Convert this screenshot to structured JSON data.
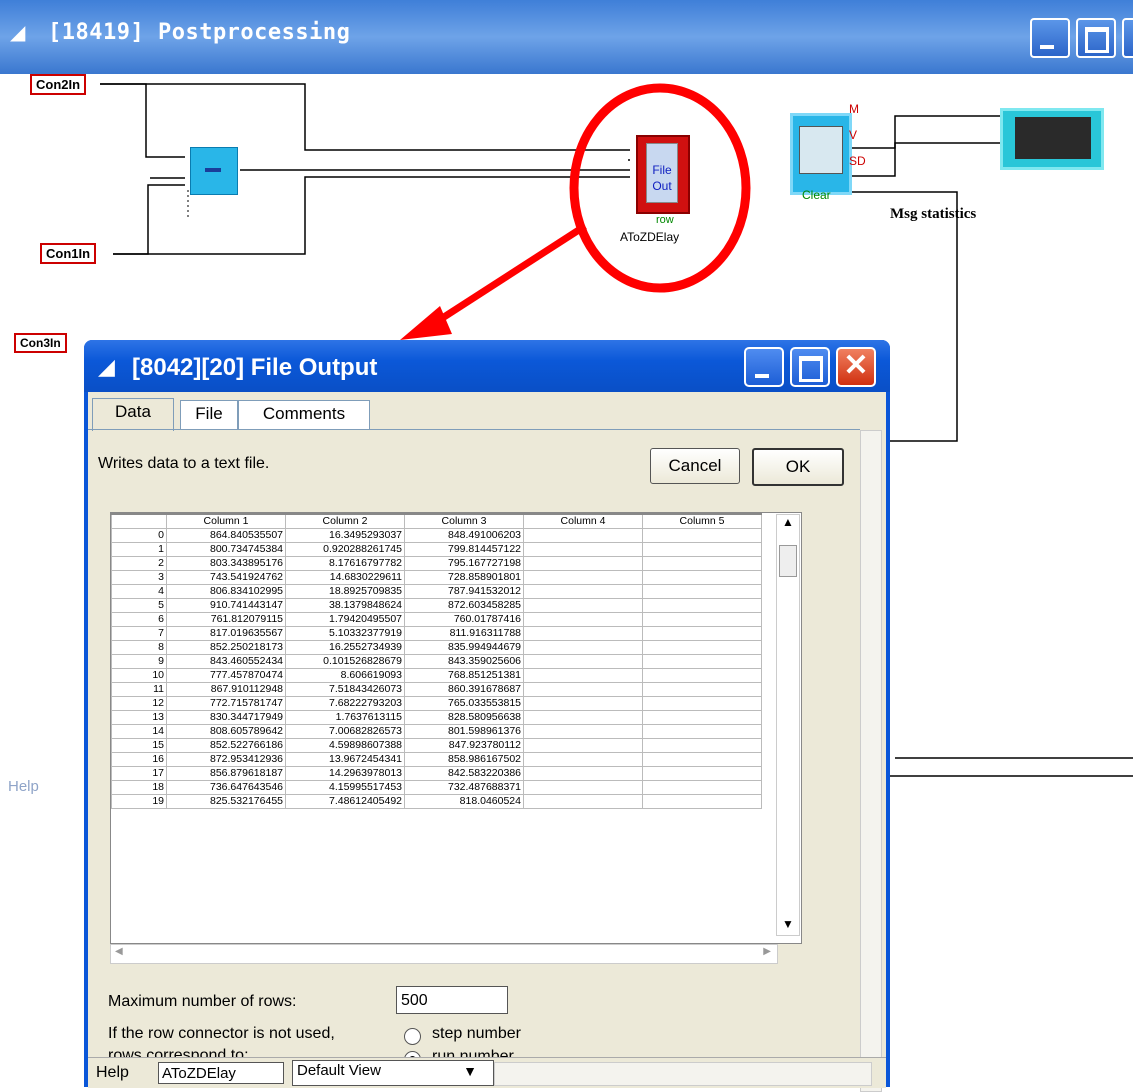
{
  "main_window": {
    "title": "[18419]  Postprocessing"
  },
  "blocks": {
    "con2in": "Con2In",
    "con1in": "Con1In",
    "con3in": "Con3In",
    "file_out_text": "File\nOut",
    "file_out_row": "row",
    "file_out_name": "AToZDElay",
    "stat_ports": [
      "M",
      "V",
      "SD"
    ],
    "stat_clear": "Clear",
    "msg_statistics": "Msg statistics",
    "help_left": "Help"
  },
  "dialog": {
    "title": "[8042][20]  File Output",
    "tabs": [
      "Data",
      "File",
      "Comments"
    ],
    "description": "Writes data to a text file.",
    "cancel_label": "Cancel",
    "ok_label": "OK",
    "table": {
      "columns": [
        "Column 1",
        "Column 2",
        "Column 3",
        "Column 4",
        "Column 5"
      ],
      "rows": [
        [
          "0",
          "864.840535507",
          "16.3495293037",
          "848.491006203",
          "",
          ""
        ],
        [
          "1",
          "800.734745384",
          "0.920288261745",
          "799.814457122",
          "",
          ""
        ],
        [
          "2",
          "803.343895176",
          "8.17616797782",
          "795.167727198",
          "",
          ""
        ],
        [
          "3",
          "743.541924762",
          "14.6830229611",
          "728.858901801",
          "",
          ""
        ],
        [
          "4",
          "806.834102995",
          "18.8925709835",
          "787.941532012",
          "",
          ""
        ],
        [
          "5",
          "910.741443147",
          "38.1379848624",
          "872.603458285",
          "",
          ""
        ],
        [
          "6",
          "761.812079115",
          "1.79420495507",
          "760.01787416",
          "",
          ""
        ],
        [
          "7",
          "817.019635567",
          "5.10332377919",
          "811.916311788",
          "",
          ""
        ],
        [
          "8",
          "852.250218173",
          "16.2552734939",
          "835.994944679",
          "",
          ""
        ],
        [
          "9",
          "843.460552434",
          "0.101526828679",
          "843.359025606",
          "",
          ""
        ],
        [
          "10",
          "777.457870474",
          "8.606619093",
          "768.851251381",
          "",
          ""
        ],
        [
          "11",
          "867.910112948",
          "7.51843426073",
          "860.391678687",
          "",
          ""
        ],
        [
          "12",
          "772.715781747",
          "7.68222793203",
          "765.033553815",
          "",
          ""
        ],
        [
          "13",
          "830.344717949",
          "1.7637613115",
          "828.580956638",
          "",
          ""
        ],
        [
          "14",
          "808.605789642",
          "7.00682826573",
          "801.598961376",
          "",
          ""
        ],
        [
          "15",
          "852.522766186",
          "4.59898607388",
          "847.923780112",
          "",
          ""
        ],
        [
          "16",
          "872.953412936",
          "13.9672454341",
          "858.986167502",
          "",
          ""
        ],
        [
          "17",
          "856.879618187",
          "14.2963978013",
          "842.583220386",
          "",
          ""
        ],
        [
          "18",
          "736.647643546",
          "4.15995517453",
          "732.487688371",
          "",
          ""
        ],
        [
          "19",
          "825.532176455",
          "7.48612405492",
          "818.0460524",
          "",
          ""
        ]
      ]
    },
    "max_rows_label": "Maximum number of rows:",
    "max_rows_value": "500",
    "row_connector_label_1": "If the row connector is not used,",
    "row_connector_label_2": "rows correspond to:",
    "radio_step": "step number",
    "radio_run": "run number",
    "radio_selected": "run number",
    "footer": {
      "help": "Help",
      "name_value": "AToZDElay",
      "view_value": "Default View"
    }
  },
  "colors": {
    "title_bar": "#3f7fd8",
    "dialog_frame": "#0a56d8",
    "annotation": "#ff0000",
    "block_cyan": "#29b6e8"
  }
}
